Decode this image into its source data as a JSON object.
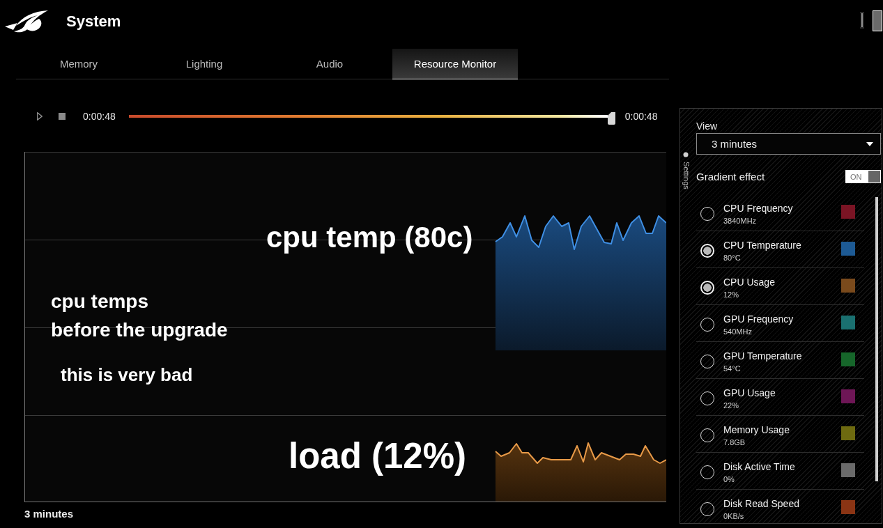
{
  "header": {
    "title": "System"
  },
  "tabs": [
    {
      "label": "Memory",
      "selected": false
    },
    {
      "label": "Lighting",
      "selected": false
    },
    {
      "label": "Audio",
      "selected": false
    },
    {
      "label": "Resource Monitor",
      "selected": true
    }
  ],
  "playback": {
    "elapsed": "0:00:48",
    "level": 1,
    "total": "0:00:48"
  },
  "graph": {
    "annotations": [
      {
        "text": "cpu temp (80c)"
      },
      {
        "text": "cpu temps\nbefore the upgrade"
      },
      {
        "text": "this is very bad"
      },
      {
        "text": "load (12%)"
      }
    ],
    "x_label": "3 minutes"
  },
  "settings_panel": {
    "tab_label": "Settings",
    "view": {
      "label": "View",
      "value": "3 minutes"
    },
    "gradient_effect": {
      "label": "Gradient effect",
      "on": true,
      "state_label": "ON"
    },
    "metrics": [
      {
        "name": "CPU Frequency",
        "value": "3840MHz",
        "selected": false,
        "color": "#7a1424"
      },
      {
        "name": "CPU Temperature",
        "value": "80°C",
        "selected": true,
        "color": "#1d5a94"
      },
      {
        "name": "CPU Usage",
        "value": "12%",
        "selected": true,
        "color": "#7a4a1c"
      },
      {
        "name": "GPU Frequency",
        "value": "540MHz",
        "selected": false,
        "color": "#1a7070"
      },
      {
        "name": "GPU Temperature",
        "value": "54°C",
        "selected": false,
        "color": "#16662a"
      },
      {
        "name": "GPU Usage",
        "value": "22%",
        "selected": false,
        "color": "#6e1656"
      },
      {
        "name": "Memory Usage",
        "value": "7.8GB",
        "selected": false,
        "color": "#6e6a10"
      },
      {
        "name": "Disk Active Time",
        "value": "0%",
        "selected": false,
        "color": "#6a6a6a"
      },
      {
        "name": "Disk Read Speed",
        "value": "0KB/s",
        "selected": false,
        "color": "#8a3414"
      }
    ]
  }
}
